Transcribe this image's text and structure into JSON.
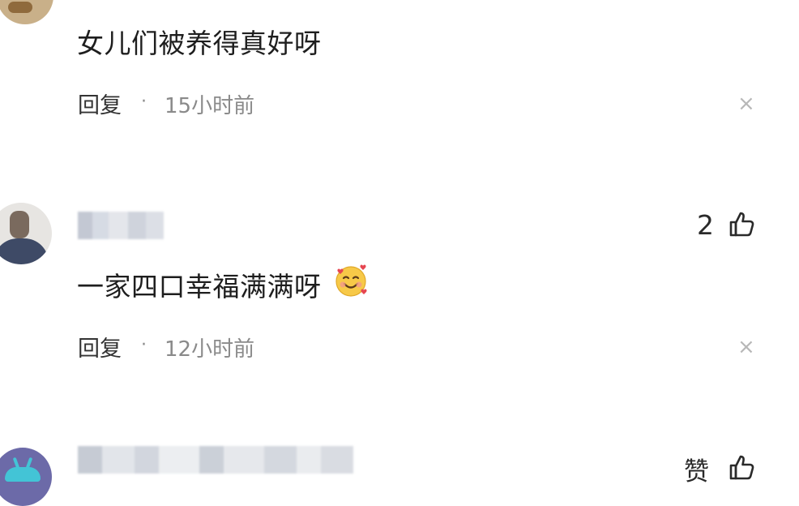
{
  "comments": [
    {
      "text": "女儿们被养得真好呀",
      "reply_label": "回复",
      "separator": "·",
      "time": "15小时前",
      "close_icon": "×"
    },
    {
      "like_count": "2",
      "text": "一家四口幸福满满呀",
      "emoji": "smiling-face-with-hearts-icon",
      "reply_label": "回复",
      "separator": "·",
      "time": "12小时前",
      "close_icon": "×"
    },
    {
      "like_label": "赞"
    }
  ],
  "colors": {
    "text": "#1e1e1e",
    "meta": "#8a8a8a",
    "close": "#b7b7b7"
  }
}
